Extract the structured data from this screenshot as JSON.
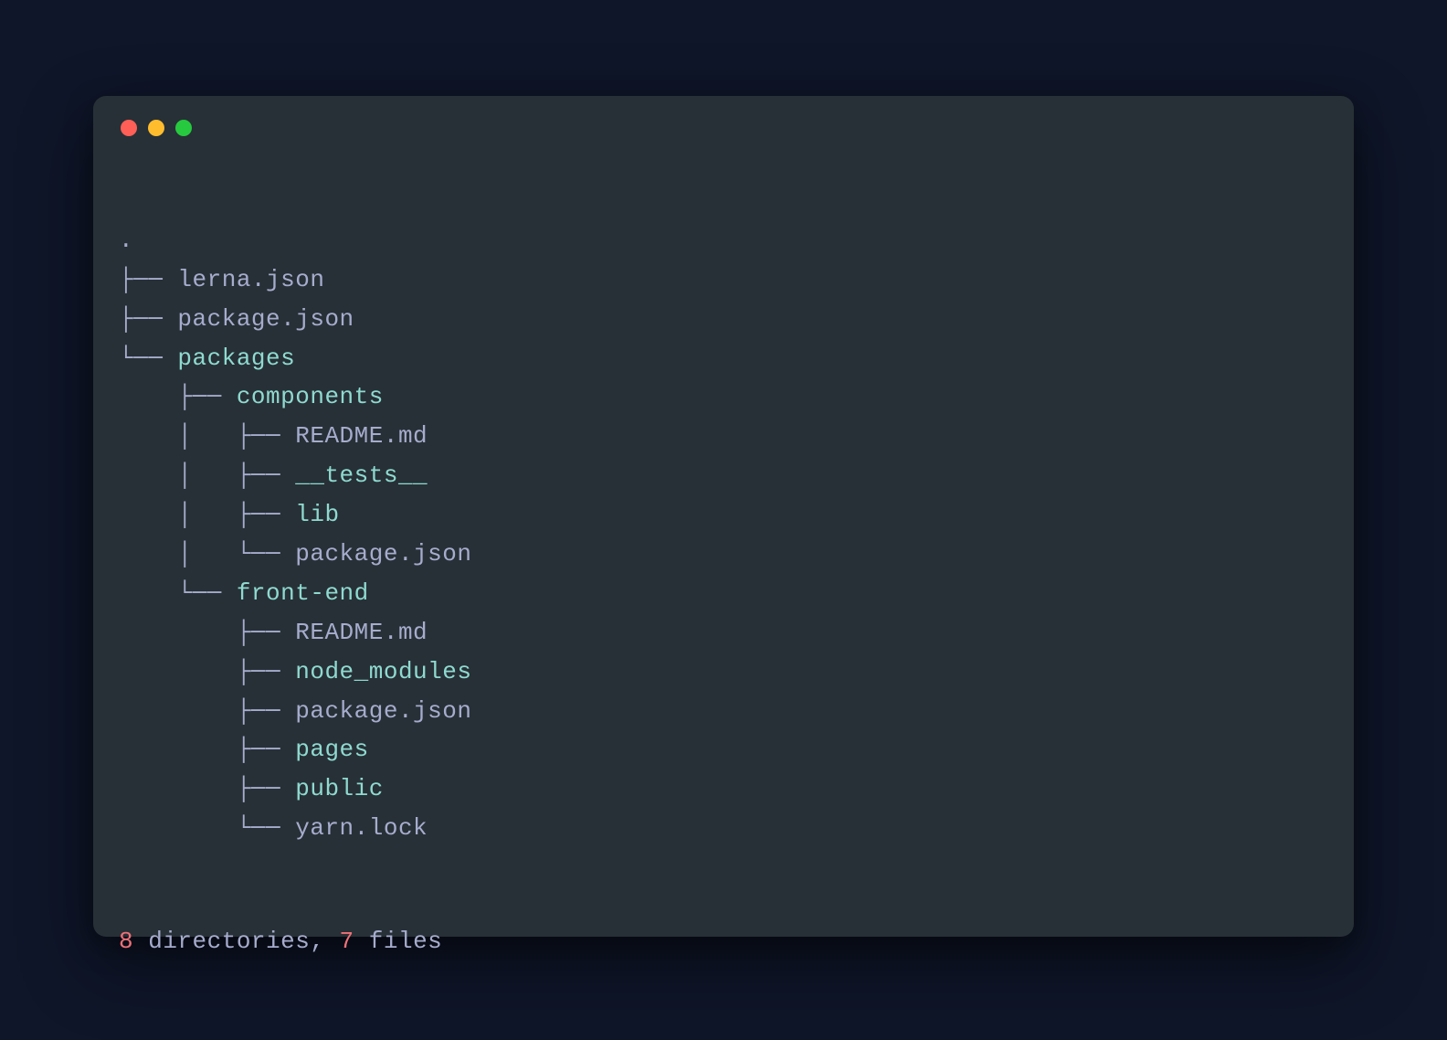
{
  "colors": {
    "background": "#0f1629",
    "terminal_bg": "#273036",
    "text_default": "#a6accd",
    "text_dir": "#8fdad0",
    "text_number": "#f07178",
    "traffic_close": "#ff5f56",
    "traffic_min": "#ffbd2e",
    "traffic_max": "#27c93f"
  },
  "tree": {
    "root": ".",
    "lines": [
      {
        "prefix": "├── ",
        "name": "lerna.json",
        "type": "file"
      },
      {
        "prefix": "├── ",
        "name": "package.json",
        "type": "file"
      },
      {
        "prefix": "└── ",
        "name": "packages",
        "type": "dir"
      },
      {
        "prefix": "    ├── ",
        "name": "components",
        "type": "dir"
      },
      {
        "prefix": "    │   ├── ",
        "name": "README.md",
        "type": "file"
      },
      {
        "prefix": "    │   ├── ",
        "name": "__tests__",
        "type": "dir"
      },
      {
        "prefix": "    │   ├── ",
        "name": "lib",
        "type": "dir"
      },
      {
        "prefix": "    │   └── ",
        "name": "package.json",
        "type": "file"
      },
      {
        "prefix": "    └── ",
        "name": "front-end",
        "type": "dir"
      },
      {
        "prefix": "        ├── ",
        "name": "README.md",
        "type": "file"
      },
      {
        "prefix": "        ├── ",
        "name": "node_modules",
        "type": "dir"
      },
      {
        "prefix": "        ├── ",
        "name": "package.json",
        "type": "file"
      },
      {
        "prefix": "        ├── ",
        "name": "pages",
        "type": "dir"
      },
      {
        "prefix": "        ├── ",
        "name": "public",
        "type": "dir"
      },
      {
        "prefix": "        └── ",
        "name": "yarn.lock",
        "type": "file"
      }
    ]
  },
  "summary": {
    "dir_count": "8",
    "dir_label": " directories, ",
    "file_count": "7",
    "file_label": " files"
  }
}
